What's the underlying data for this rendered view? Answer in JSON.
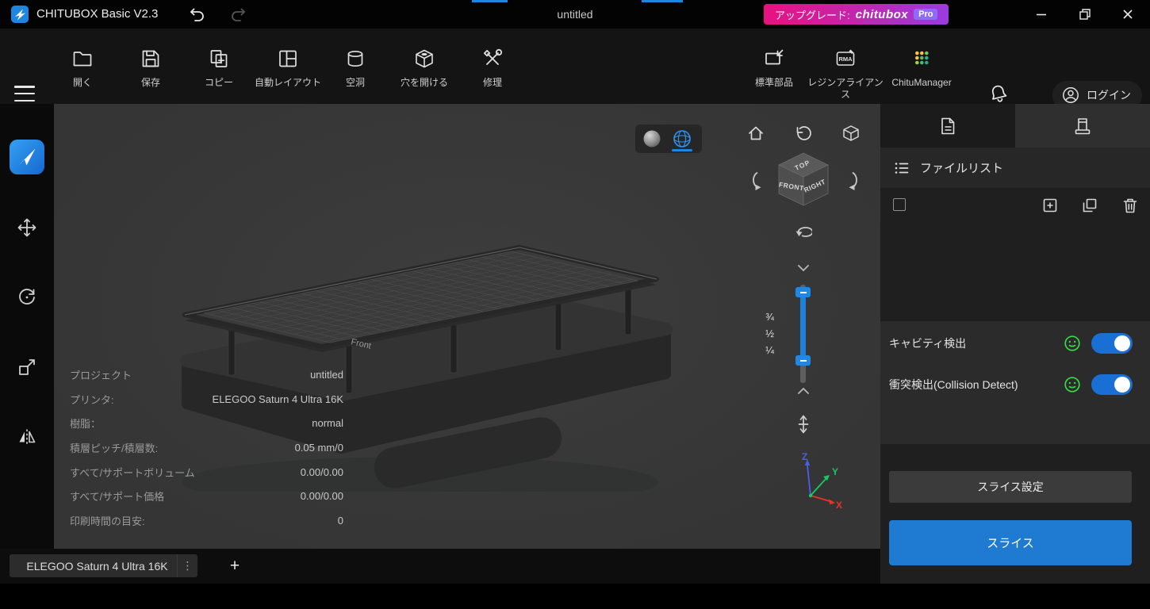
{
  "titlebar": {
    "app_title": "CHITUBOX Basic V2.3",
    "document_title": "untitled",
    "upgrade": {
      "prefix": "アップグレード:",
      "brand": "chitubox",
      "badge": "Pro"
    }
  },
  "toolbar": {
    "items": [
      {
        "label": "開く"
      },
      {
        "label": "保存"
      },
      {
        "label": "コピー"
      },
      {
        "label": "自動レイアウト"
      },
      {
        "label": "空洞"
      },
      {
        "label": "穴を開ける"
      },
      {
        "label": "修理"
      }
    ],
    "right_items": [
      {
        "label": "標準部品"
      },
      {
        "label": "レジンアライアンス"
      },
      {
        "label": "ChituManager"
      }
    ],
    "login_label": "ログイン"
  },
  "viewport": {
    "project_info": [
      {
        "label": "プロジェクト",
        "value": "untitled"
      },
      {
        "label": "プリンタ:",
        "value": "ELEGOO Saturn 4 Ultra 16K"
      },
      {
        "label": "樹脂：",
        "value": "normal"
      },
      {
        "label": "積層ピッチ/積層数:",
        "value": "0.05 mm/0"
      },
      {
        "label": "すべて/サポートボリューム",
        "value": "0.00/0.00"
      },
      {
        "label": "すべて/サポート価格",
        "value": "0.00/0.00"
      },
      {
        "label": "印刷時間の目安:",
        "value": "0"
      }
    ],
    "nav_cube": {
      "top": "TOP",
      "front": "FRONT",
      "right": "RIGHT"
    },
    "clip_fractions": [
      "¾",
      "½",
      "¼"
    ],
    "model_label": "Front",
    "axes": {
      "x": "X",
      "y": "Y",
      "z": "Z"
    }
  },
  "right_panel": {
    "file_list_title": "ファイルリスト",
    "detections": [
      {
        "label": "キャビティ検出",
        "state": "on"
      },
      {
        "label": "衝突検出(Collision Detect)",
        "state": "on"
      }
    ],
    "slice_settings_label": "スライス設定",
    "slice_label": "スライス"
  },
  "bottom_bar": {
    "printer_name": "ELEGOO Saturn 4 Ultra 16K",
    "menu_glyph": "⋮",
    "add_glyph": "+"
  },
  "colors": {
    "accent_blue": "#1f86e0",
    "toggle_on": "#1a6fd4",
    "slice_button": "#1f7ad2",
    "upgrade_gradient_start": "#e9117f",
    "upgrade_gradient_end": "#9a3be0",
    "pro_badge": "#8f6bf7",
    "ok_green": "#35d94a"
  }
}
